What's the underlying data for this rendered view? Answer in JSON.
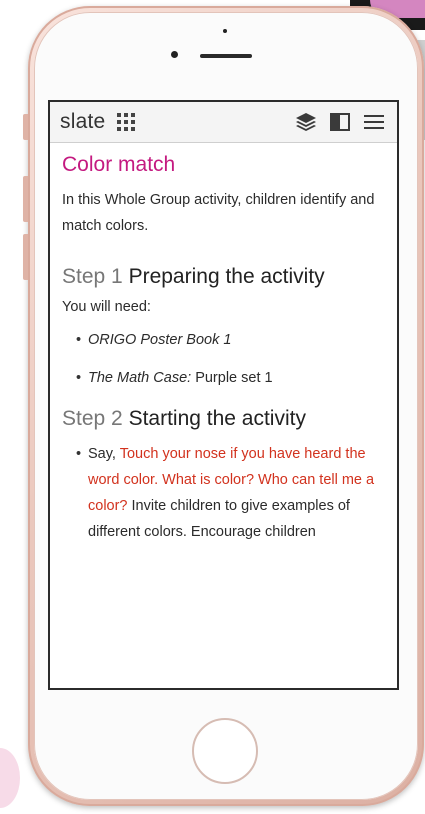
{
  "app": {
    "logo": "slate"
  },
  "icons": {
    "apps": "grid-icon",
    "layers": "layers-icon",
    "panel": "sidebar-panel-icon",
    "menu": "hamburger-menu-icon"
  },
  "lesson": {
    "title": "Color match",
    "intro": "In this Whole Group activity, children identify and match colors.",
    "step1": {
      "number": "Step 1",
      "heading": "Preparing the activity",
      "need_label": "You will need:",
      "item1_italic": "ORIGO Poster Book 1",
      "item2_italic": "The Math Case:",
      "item2_rest": " Purple set 1"
    },
    "step2": {
      "number": "Step 2",
      "heading": "Starting the activity",
      "say_label": "Say, ",
      "quote": "Touch your nose if you have heard the word color. What is color? Who can tell me a color?",
      "rest": " Invite children to give examples of different colors. Encourage children"
    }
  },
  "colors": {
    "title": "#c41a80",
    "quote": "#d2321e"
  }
}
